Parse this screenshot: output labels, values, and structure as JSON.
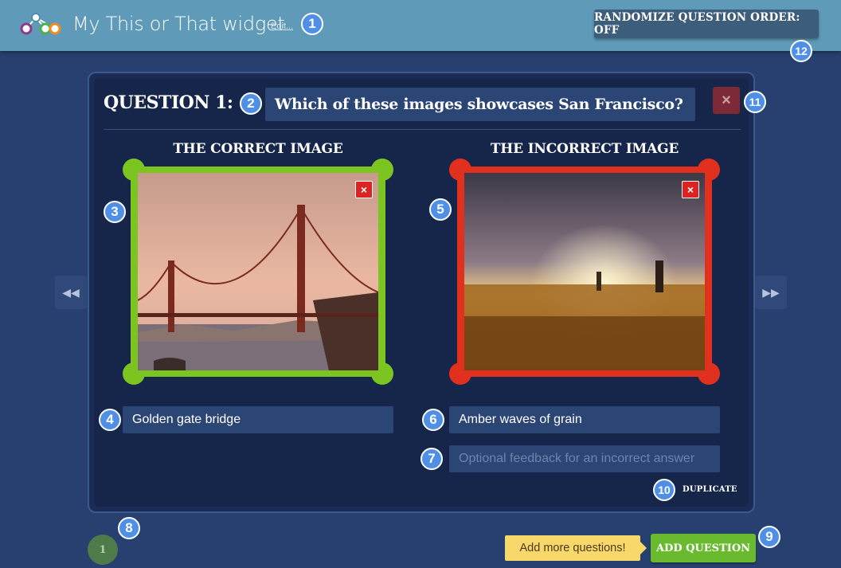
{
  "header": {
    "title": "My This or That widget",
    "edit_label": "Edit...",
    "randomize_label": "RANDOMIZE QUESTION ORDER: OFF"
  },
  "question": {
    "label": "QUESTION 1:",
    "text": "Which of these images showcases San Francisco?"
  },
  "correct": {
    "title": "THE CORRECT IMAGE",
    "answer": "Golden gate bridge",
    "frame_color": "#7cc520"
  },
  "incorrect": {
    "title": "THE INCORRECT IMAGE",
    "answer": "Amber waves of grain",
    "feedback_placeholder": "Optional feedback for an incorrect answer",
    "frame_color": "#e2301e"
  },
  "icons": {
    "close": "×",
    "prev": "◀◀",
    "next": "▶▶"
  },
  "footer": {
    "duplicate_label": "DUPLICATE",
    "page_number": "1",
    "hint": "Add more questions!",
    "add_label": "ADD QUESTION"
  },
  "badges": [
    "1",
    "2",
    "3",
    "4",
    "5",
    "6",
    "7",
    "8",
    "9",
    "10",
    "11",
    "12"
  ]
}
